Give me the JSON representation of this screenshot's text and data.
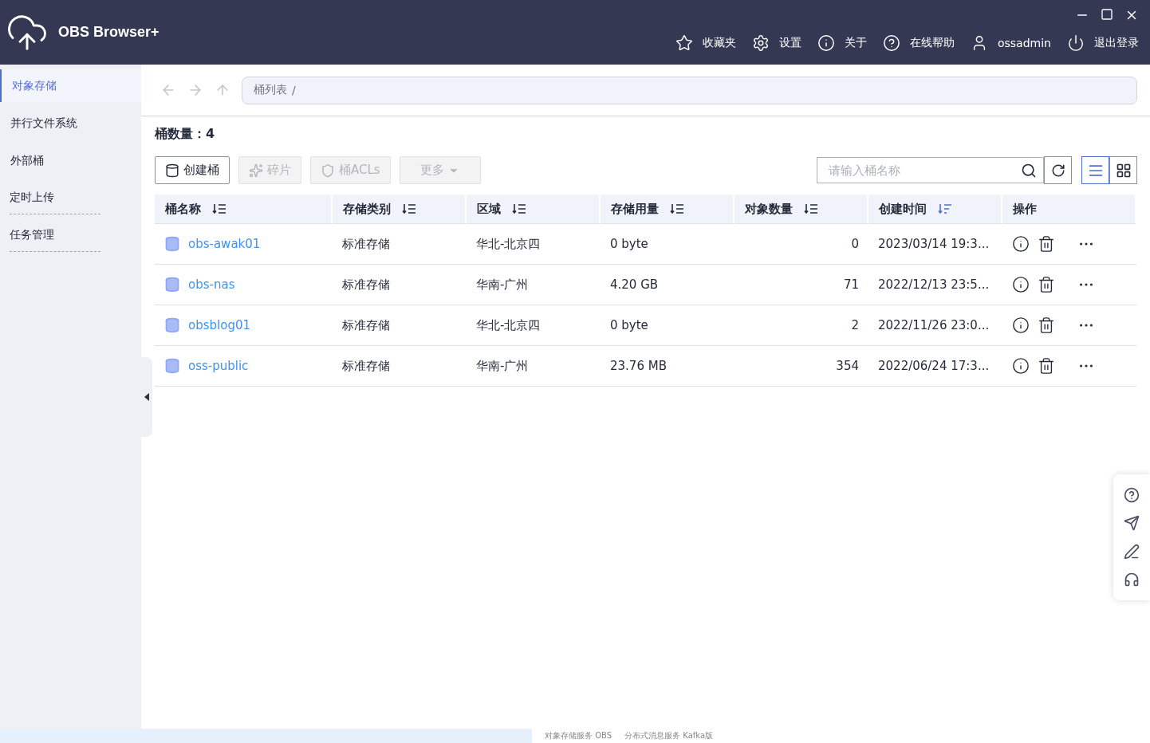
{
  "header": {
    "title": "OBS Browser+",
    "nav": [
      {
        "label": "收藏夹"
      },
      {
        "label": "设置"
      },
      {
        "label": "关于"
      },
      {
        "label": "在线帮助"
      },
      {
        "label": "ossadmin"
      },
      {
        "label": "退出登录"
      }
    ]
  },
  "sidebar": {
    "items": [
      {
        "label": "对象存储",
        "selected": true
      },
      {
        "label": "并行文件系统",
        "selected": false
      },
      {
        "label": "外部桶",
        "selected": false
      },
      {
        "label": "定时上传",
        "selected": false
      },
      {
        "label": "任务管理",
        "selected": false
      }
    ]
  },
  "breadcrumb": {
    "items": [
      "桶列表"
    ],
    "separator": "/"
  },
  "bucket_count": "桶数量：4",
  "toolbar": [
    {
      "label": "创建桶",
      "disabled": false,
      "kind": "create"
    },
    {
      "label": "碎片",
      "disabled": true,
      "kind": "fragments"
    },
    {
      "label": "桶ACLs",
      "disabled": true,
      "kind": "acl"
    },
    {
      "label": "更多",
      "disabled": true,
      "kind": "dropdown"
    }
  ],
  "search": {
    "placeholder": "请输入桶名称"
  },
  "view_modes": [
    {
      "kind": "list",
      "selected": true
    },
    {
      "kind": "grid",
      "selected": false
    }
  ],
  "table": {
    "columns": [
      {
        "label": "桶名称",
        "sortable": true,
        "sorted": false
      },
      {
        "label": "存储类别",
        "sortable": true,
        "sorted": false
      },
      {
        "label": "区域",
        "sortable": true,
        "sorted": false
      },
      {
        "label": "存储用量",
        "sortable": true,
        "sorted": false
      },
      {
        "label": "对象数量",
        "sortable": true,
        "sorted": false
      },
      {
        "label": "创建时间",
        "sortable": true,
        "sorted": true
      },
      {
        "label": "操作",
        "sortable": false,
        "sorted": false
      }
    ],
    "rows": [
      {
        "name": "obs-awak01",
        "storage_class": "标准存储",
        "region": "华北-北京四",
        "usage": "0 byte",
        "objects": "0",
        "created": "2023/03/14 19:3..."
      },
      {
        "name": "obs-nas",
        "storage_class": "标准存储",
        "region": "华南-广州",
        "usage": "4.20 GB",
        "objects": "71",
        "created": "2022/12/13 23:5..."
      },
      {
        "name": "obsblog01",
        "storage_class": "标准存储",
        "region": "华北-北京四",
        "usage": "0 byte",
        "objects": "2",
        "created": "2022/11/26 23:0..."
      },
      {
        "name": "oss-public",
        "storage_class": "标准存储",
        "region": "华南-广州",
        "usage": "23.76 MB",
        "objects": "354",
        "created": "2022/06/24 17:3..."
      }
    ]
  },
  "taskbar_strip": {
    "items": [
      "对象存储服务 OBS",
      "分布式消息服务 Kafka版"
    ]
  }
}
